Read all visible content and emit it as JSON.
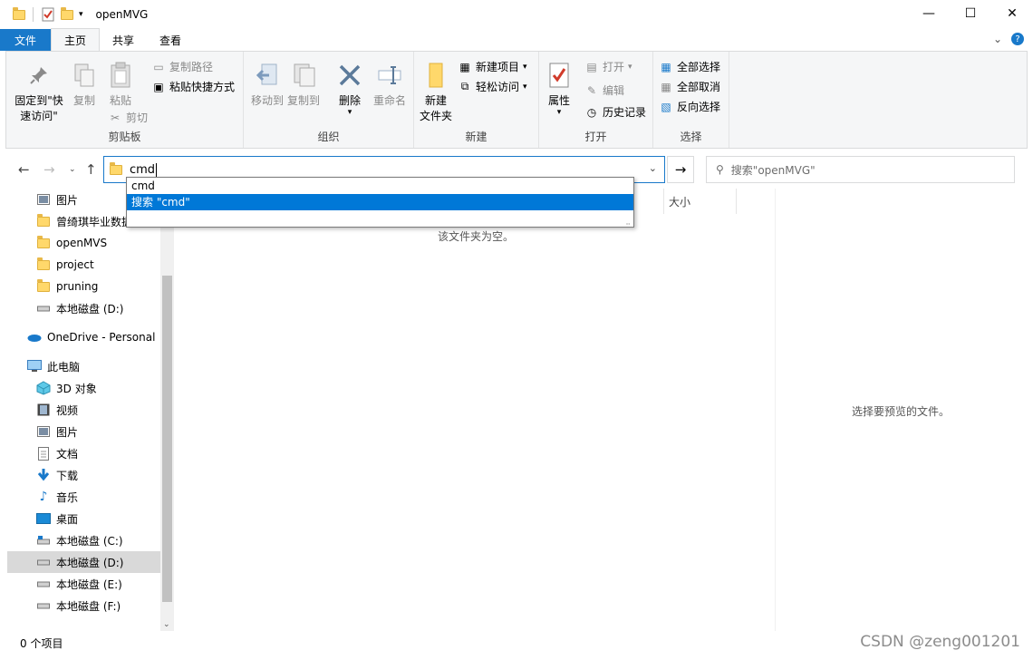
{
  "window": {
    "title": "openMVG",
    "controls": {
      "minimize": "—",
      "maximize": "☐",
      "close": "✕"
    }
  },
  "ribbon_tabs": [
    "文件",
    "主页",
    "共享",
    "查看"
  ],
  "ribbon": {
    "clipboard": {
      "label": "剪贴板",
      "pin": "固定到\"快\n速访问\"",
      "copy": "复制",
      "paste": "粘贴",
      "copy_path": "复制路径",
      "paste_shortcut": "粘贴快捷方式",
      "cut": "剪切"
    },
    "organize": {
      "label": "组织",
      "move_to": "移动到",
      "copy_to": "复制到",
      "delete": "删除",
      "rename": "重命名"
    },
    "new": {
      "label": "新建",
      "new_folder_1": "新建",
      "new_folder_2": "文件夹",
      "new_item": "新建项目",
      "easy_access": "轻松访问"
    },
    "open": {
      "label": "打开",
      "properties": "属性",
      "open": "打开",
      "edit": "编辑",
      "history": "历史记录"
    },
    "select": {
      "label": "选择",
      "select_all": "全部选择",
      "select_none": "全部取消",
      "invert": "反向选择"
    }
  },
  "address": {
    "value": "cmd",
    "suggestions": [
      "cmd",
      "搜索 \"cmd\""
    ]
  },
  "search": {
    "placeholder": "搜索\"openMVG\""
  },
  "nav_pane": {
    "items": [
      {
        "label": "图片",
        "icon": "pictures-icon"
      },
      {
        "label": "曾绮琪毕业数据",
        "icon": "folder-icon"
      },
      {
        "label": "openMVS",
        "icon": "folder-icon"
      },
      {
        "label": "project",
        "icon": "folder-icon"
      },
      {
        "label": "pruning",
        "icon": "folder-icon"
      },
      {
        "label": "本地磁盘 (D:)",
        "icon": "drive-icon"
      },
      {
        "label": "OneDrive - Personal",
        "icon": "onedrive-icon"
      },
      {
        "label": "此电脑",
        "icon": "computer-icon"
      },
      {
        "label": "3D 对象",
        "icon": "3d-objects-icon"
      },
      {
        "label": "视频",
        "icon": "video-icon"
      },
      {
        "label": "图片",
        "icon": "pictures-icon"
      },
      {
        "label": "文档",
        "icon": "document-icon"
      },
      {
        "label": "下载",
        "icon": "download-icon"
      },
      {
        "label": "音乐",
        "icon": "music-icon"
      },
      {
        "label": "桌面",
        "icon": "desktop-icon"
      },
      {
        "label": "本地磁盘 (C:)",
        "icon": "drive-icon"
      },
      {
        "label": "本地磁盘 (D:)",
        "icon": "drive-icon"
      },
      {
        "label": "本地磁盘 (E:)",
        "icon": "drive-icon"
      },
      {
        "label": "本地磁盘 (F:)",
        "icon": "drive-icon"
      }
    ],
    "selected_index": 16
  },
  "content": {
    "column_size": "大小",
    "empty_message": "该文件夹为空。",
    "preview_message": "选择要预览的文件。"
  },
  "status": {
    "items_count": "0 个项目"
  },
  "watermark": "CSDN @zeng001201"
}
